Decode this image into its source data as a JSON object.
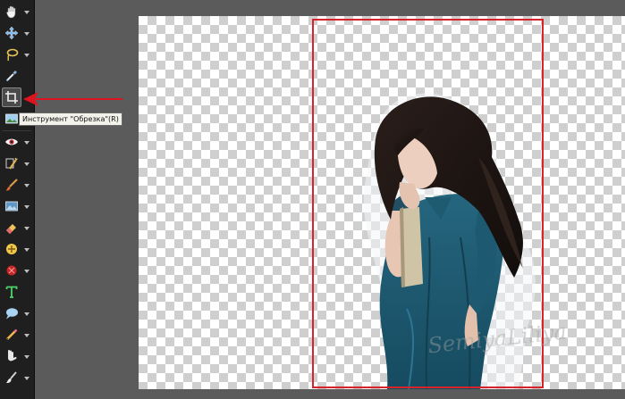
{
  "tooltip": {
    "text": "Инструмент \"Обрезка\"(R)"
  },
  "tools": [
    {
      "name": "hand-tool",
      "icon": "hand-icon"
    },
    {
      "name": "move-tool",
      "icon": "move-icon"
    },
    {
      "name": "lasso-tool",
      "icon": "lasso-icon"
    },
    {
      "name": "eyedropper-tool",
      "icon": "eyedropper-icon"
    },
    {
      "name": "crop-tool",
      "icon": "crop-icon",
      "selected": true
    },
    {
      "name": "image-tool",
      "icon": "picture-icon"
    },
    {
      "name": "red-eye-tool",
      "icon": "eye-icon"
    },
    {
      "name": "adjust-brush-tool",
      "icon": "wand-brush-icon"
    },
    {
      "name": "brush-tool",
      "icon": "brush-icon"
    },
    {
      "name": "fill-tool",
      "icon": "picture-fill-icon"
    },
    {
      "name": "eraser-tool",
      "icon": "eraser-icon"
    },
    {
      "name": "retouch-tool",
      "icon": "clone-icon"
    },
    {
      "name": "shape-tool",
      "icon": "shape-icon"
    },
    {
      "name": "text-tool",
      "icon": "text-icon"
    },
    {
      "name": "speech-bubble-tool",
      "icon": "speech-bubble-icon"
    },
    {
      "name": "pencil-tool",
      "icon": "pencil-icon"
    },
    {
      "name": "smudge-tool",
      "icon": "smudge-icon"
    },
    {
      "name": "paint-tool",
      "icon": "paint-icon"
    }
  ],
  "watermark": "SemiyaLiliya",
  "colors": {
    "toolbar": "#1f1f1f",
    "workspace": "#5b5b5b",
    "crop_border": "#d8232a",
    "arrow": "#e0141e",
    "dress": "#1d5a72",
    "hair": "#1a1412"
  }
}
